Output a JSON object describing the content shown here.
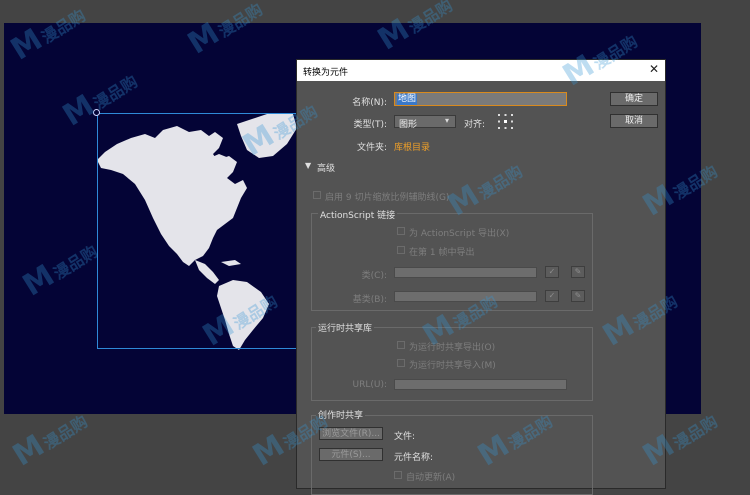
{
  "dialog": {
    "title": "转换为元件",
    "close_glyph": "✕",
    "name_label": "名称(N):",
    "name_value": "地图",
    "type_label": "类型(T):",
    "type_value": "图形",
    "align_label": "对齐:",
    "folder_label": "文件夹:",
    "folder_value": "库根目录",
    "ok_label": "确定",
    "cancel_label": "取消",
    "advanced_label": "高级",
    "nine_slice_label": "启用 9 切片缩放比例辅助线(G)",
    "actionscript": {
      "group_label": "ActionScript 链接",
      "export_label": "为 ActionScript 导出(X)",
      "frame1_label": "在第 1 帧中导出",
      "class_label": "类(C):",
      "base_label": "基类(B):"
    },
    "runtime": {
      "group_label": "运行时共享库",
      "export_label": "为运行时共享导出(O)",
      "import_label": "为运行时共享导入(M)",
      "url_label": "URL(U):"
    },
    "authortime": {
      "group_label": "创作时共享",
      "browse_file_label": "浏览文件(R)...",
      "file_label": "文件:",
      "symbol_btn_label": "元件(S)...",
      "symbol_name_label": "元件名称:",
      "auto_update_label": "自动更新(A)"
    }
  },
  "stage": {
    "background": "#040436",
    "selection_color": "#2f8ad8"
  },
  "watermark": {
    "mark": "M",
    "text": "漫品购"
  },
  "colors": {
    "accent_link": "#f0a028",
    "dialog_bg": "#535353",
    "workspace": "#444444"
  }
}
